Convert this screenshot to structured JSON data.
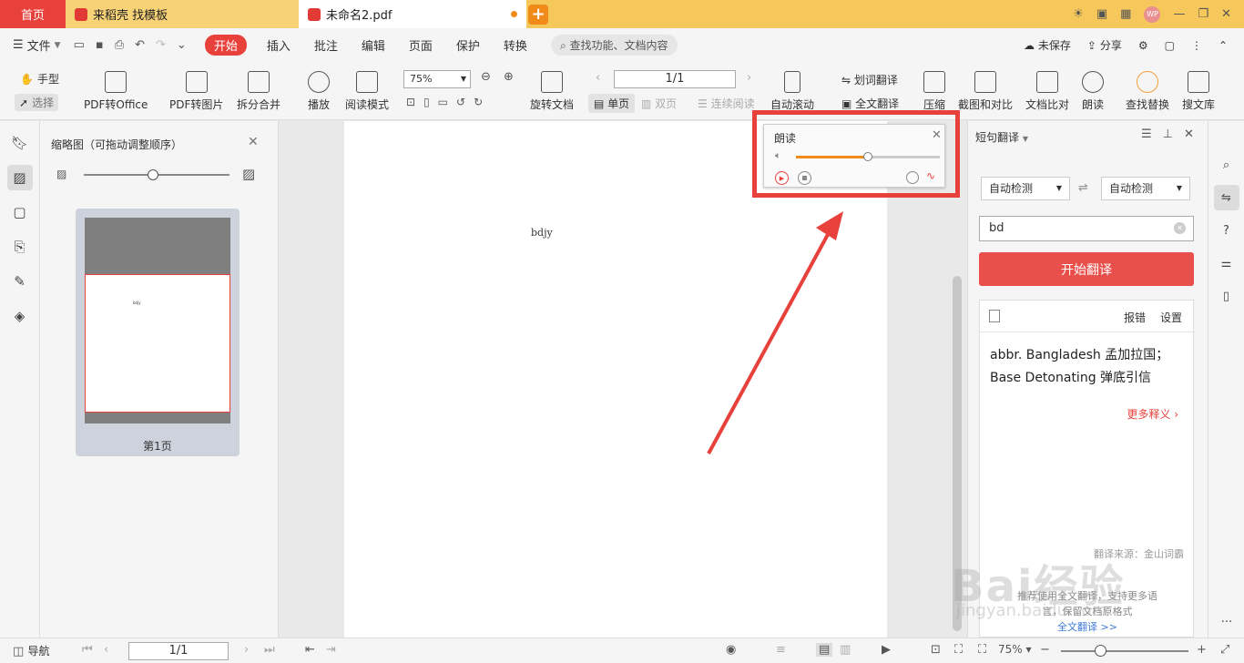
{
  "tabs": {
    "home": "首页",
    "template": "来稻壳 找模板",
    "document": "未命名2.pdf"
  },
  "menubar": {
    "file": "文件",
    "items": [
      "开始",
      "插入",
      "批注",
      "编辑",
      "页面",
      "保护",
      "转换"
    ],
    "search_placeholder": "查找功能、文档内容",
    "unsaved": "未保存",
    "share": "分享"
  },
  "toolbar": {
    "hand": "手型",
    "select": "选择",
    "pdf_to_office": "PDF转Office",
    "pdf_to_image": "PDF转图片",
    "split_merge": "拆分合并",
    "play": "播放",
    "read_mode": "阅读模式",
    "zoom": "75%",
    "rotate_doc": "旋转文档",
    "page_value": "1/1",
    "single_page": "单页",
    "double_page": "双页",
    "continuous": "连续阅读",
    "auto_scroll": "自动滚动",
    "word_translate": "划词翻译",
    "full_translate": "全文翻译",
    "compress": "压缩",
    "screenshot_compare": "截图和对比",
    "doc_compare": "文档比对",
    "read_aloud": "朗读",
    "find_replace": "查找替换",
    "search_library": "搜文库"
  },
  "thumbnail_panel": {
    "title": "缩略图（可拖动调整顺序）",
    "page_label": "第1页"
  },
  "document": {
    "text": "bdjy"
  },
  "read_popup": {
    "title": "朗读",
    "volume_level": 0.5
  },
  "translate_panel": {
    "title": "短句翻译",
    "source_lang": "自动检测",
    "target_lang": "自动检测",
    "input_value": "bd",
    "translate_button": "开始翻译",
    "report": "报错",
    "settings": "设置",
    "result_line1": "abbr. Bangladesh 孟加拉国；",
    "result_line2": "Base Detonating 弹底引信",
    "more": "更多释义",
    "source": "翻译来源：金山词霸",
    "promo_line1": "推荐使用全文翻译，支持更多语",
    "promo_line2": "言，保留文档原格式",
    "promo_link": "全文翻译 >>"
  },
  "statusbar": {
    "nav": "导航",
    "page_value": "1/1",
    "zoom": "75%",
    "zoom_level": 0.31
  },
  "watermark": {
    "brand": "Bai经验",
    "url": "jingyan.baidu.com"
  },
  "colors": {
    "accent": "#e8413c",
    "tabbar": "#f6c75a",
    "orange": "#f08b1a"
  }
}
